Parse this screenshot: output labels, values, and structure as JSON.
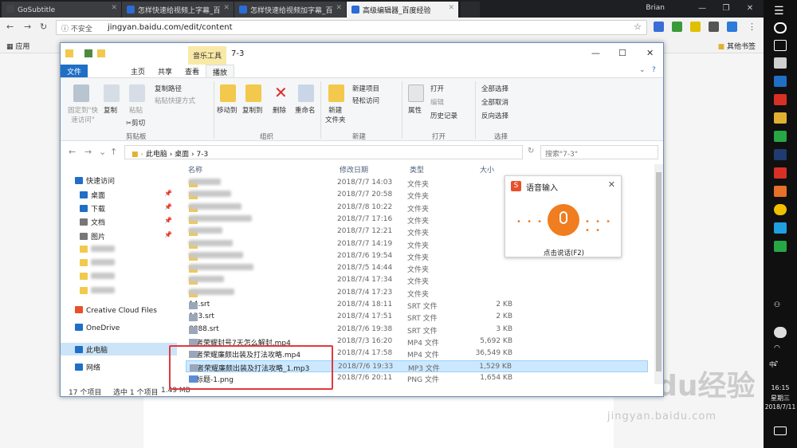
{
  "browser": {
    "tabs": [
      {
        "label": "GoSubtitle"
      },
      {
        "label": "怎样快速给视频上字幕_百"
      },
      {
        "label": "怎样快速给视频加字幕_百"
      },
      {
        "label": "高级编辑器_百度经验"
      }
    ],
    "user": "Brian",
    "security": "不安全",
    "url": "jingyan.baidu.com/edit/content",
    "bookmarks": {
      "apps": "应用",
      "other": "其他书签"
    }
  },
  "explorer": {
    "context_tab": "音乐工具",
    "title": "7-3",
    "ribbon_tabs": [
      "文件",
      "主页",
      "共享",
      "查看",
      "播放"
    ],
    "clipboard": {
      "pin": "固定到\"快速访问\"",
      "copy": "复制",
      "paste": "粘贴",
      "copy_path": "复制路径",
      "paste_shortcut": "粘贴快捷方式",
      "cut": "剪切",
      "group": "剪贴板"
    },
    "organize": {
      "move": "移动到",
      "copyto": "复制到",
      "delete": "删除",
      "rename": "重命名",
      "group": "组织"
    },
    "new": {
      "folder": "新建\n文件夹",
      "item": "新建项目",
      "easy": "轻松访问",
      "group": "新建"
    },
    "open": {
      "props": "属性",
      "open": "打开",
      "edit": "编辑",
      "history": "历史记录",
      "group": "打开"
    },
    "select": {
      "all": "全部选择",
      "none": "全部取消",
      "invert": "反向选择",
      "group": "选择"
    },
    "path": [
      "此电脑",
      "桌面",
      "7-3"
    ],
    "search_placeholder": "搜索\"7-3\"",
    "sidebar": [
      {
        "label": "快速访问",
        "icon": "star-icon"
      },
      {
        "label": "桌面",
        "icon": "desktop-icon",
        "pinned": true
      },
      {
        "label": "下载",
        "icon": "download-icon",
        "pinned": true
      },
      {
        "label": "文档",
        "icon": "document-icon",
        "pinned": true
      },
      {
        "label": "图片",
        "icon": "picture-icon",
        "pinned": true
      },
      {
        "label": "",
        "icon": "folder-icon"
      },
      {
        "label": "",
        "icon": "folder-icon"
      },
      {
        "label": "",
        "icon": "folder-icon"
      },
      {
        "label": "",
        "icon": "folder-icon"
      },
      {
        "label": "Creative Cloud Files",
        "icon": "creative-cloud-icon"
      },
      {
        "label": "OneDrive",
        "icon": "cloud-icon"
      },
      {
        "label": "此电脑",
        "icon": "computer-icon"
      },
      {
        "label": "网络",
        "icon": "network-icon"
      }
    ],
    "columns": {
      "name": "名称",
      "date": "修改日期",
      "type": "类型",
      "size": "大小"
    },
    "files": [
      {
        "name": "",
        "date": "2018/7/7 14:03",
        "type": "文件夹",
        "size": "",
        "icon": "folder"
      },
      {
        "name": "",
        "date": "2018/7/7 20:58",
        "type": "文件夹",
        "size": "",
        "icon": "folder"
      },
      {
        "name": "",
        "date": "2018/7/8 10:22",
        "type": "文件夹",
        "size": "",
        "icon": "folder"
      },
      {
        "name": "",
        "date": "2018/7/7 17:16",
        "type": "文件夹",
        "size": "",
        "icon": "folder"
      },
      {
        "name": "",
        "date": "2018/7/7 12:21",
        "type": "文件夹",
        "size": "",
        "icon": "folder"
      },
      {
        "name": "",
        "date": "2018/7/7 14:19",
        "type": "文件夹",
        "size": "",
        "icon": "folder"
      },
      {
        "name": "",
        "date": "2018/7/6 19:54",
        "type": "文件夹",
        "size": "",
        "icon": "folder"
      },
      {
        "name": "",
        "date": "2018/7/5 14:44",
        "type": "文件夹",
        "size": "",
        "icon": "folder"
      },
      {
        "name": "",
        "date": "2018/7/4 17:34",
        "type": "文件夹",
        "size": "",
        "icon": "folder"
      },
      {
        "name": "",
        "date": "2018/7/4 17:23",
        "type": "文件夹",
        "size": "",
        "icon": "folder"
      },
      {
        "name": "14.srt",
        "date": "2018/7/4 18:11",
        "type": "SRT 文件",
        "size": "2 KB",
        "icon": "doc"
      },
      {
        "name": "123.srt",
        "date": "2018/7/4 17:51",
        "type": "SRT 文件",
        "size": "2 KB",
        "icon": "doc"
      },
      {
        "name": "8888.srt",
        "date": "2018/7/6 19:38",
        "type": "SRT 文件",
        "size": "3 KB",
        "icon": "doc"
      },
      {
        "name": "王者荣耀封号7天怎么解封.mp4",
        "date": "2018/7/3 16:20",
        "type": "MP4 文件",
        "size": "5,692 KB",
        "icon": "doc"
      },
      {
        "name": "王者荣耀廉颇出装及打法攻略.mp4",
        "date": "2018/7/4 17:58",
        "type": "MP4 文件",
        "size": "36,549 KB",
        "icon": "doc"
      },
      {
        "name": "王者荣耀廉颇出装及打法攻略_1.mp3",
        "date": "2018/7/6 19:33",
        "type": "MP3 文件",
        "size": "1,529 KB",
        "icon": "doc",
        "selected": true
      },
      {
        "name": "未标题-1.png",
        "date": "2018/7/6 20:11",
        "type": "PNG 文件",
        "size": "1,654 KB",
        "icon": "img"
      }
    ],
    "status": {
      "count": "17 个项目",
      "selected": "选中 1 个项目",
      "size": "1.49 MB"
    }
  },
  "voice": {
    "title": "语音输入",
    "hint": "点击说话(F2)",
    "dots": "• • • • •"
  },
  "watermark": {
    "brand": "Baidu经验",
    "url": "jingyan.baidu.com"
  },
  "taskbar": {
    "time": "16:15",
    "weekday": "星期三",
    "date": "2018/7/11",
    "ime": "中"
  }
}
